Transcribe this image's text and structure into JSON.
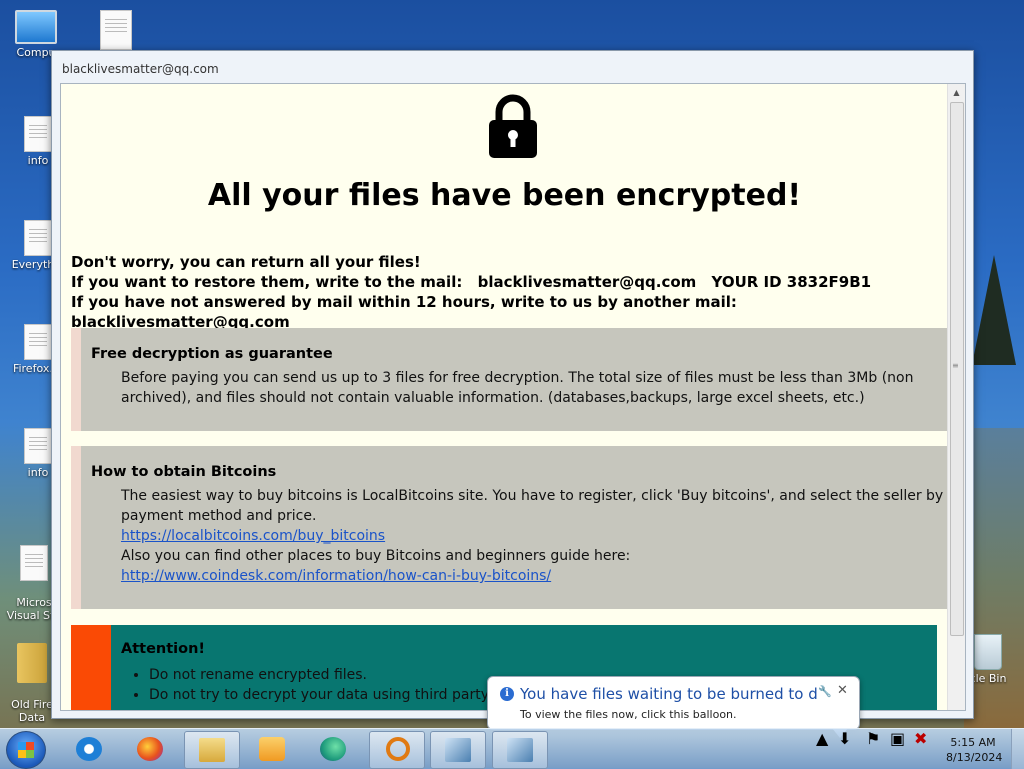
{
  "desktop": {
    "icons": [
      {
        "label": "Compu",
        "icon": "computer-icon"
      },
      {
        "label": "",
        "icon": "document-icon"
      },
      {
        "label": "info",
        "icon": "document-icon"
      },
      {
        "label": "Everythin",
        "icon": "document-icon"
      },
      {
        "label": "Firefox.In",
        "icon": "document-icon"
      },
      {
        "label": "info",
        "icon": "document-icon"
      },
      {
        "label": "Micros\nVisual Stu",
        "icon": "document-icon"
      },
      {
        "label": "Old Fire\nData",
        "icon": "folder-icon"
      },
      {
        "label": "cle Bin",
        "icon": "recycle-bin-icon"
      }
    ]
  },
  "window": {
    "title": "blacklivesmatter@qq.com",
    "headline": "All your files have been encrypted!",
    "intro": {
      "line1": "Don't worry, you can return all your files!",
      "line2_prefix": "If you want to restore them, write to the mail:",
      "line2_email": "blacklivesmatter@qq.com",
      "line2_id": "YOUR ID 3832F9B1",
      "line3_prefix": "If you have not answered by mail within 12 hours, write to us by another mail:",
      "line3_email": "blacklivesmatter@qq.com"
    },
    "free_decryption": {
      "title": "Free decryption as guarantee",
      "body": "Before paying you can send us up to 3 files for free decryption. The total size of files must be less than 3Mb (non archived), and files should not contain valuable information. (databases,backups, large excel sheets, etc.)"
    },
    "bitcoins": {
      "title": "How to obtain Bitcoins",
      "body1": "The easiest way to buy bitcoins is LocalBitcoins site. You have to register, click 'Buy bitcoins', and select the seller by payment method and price.",
      "link1": "https://localbitcoins.com/buy_bitcoins",
      "body2": "Also you can find other places to buy Bitcoins and beginners guide here:",
      "link2": "http://www.coindesk.com/information/how-can-i-buy-bitcoins/"
    },
    "attention": {
      "title": "Attention!",
      "items": [
        "Do not rename encrypted files.",
        "Do not try to decrypt your data using third party so"
      ]
    }
  },
  "balloon": {
    "title": "You have files waiting to be burned to disc",
    "text": "To view the files now, click this balloon."
  },
  "taskbar": {
    "apps": [
      {
        "name": "internet-explorer-icon",
        "color": "#1e7fd6"
      },
      {
        "name": "firefox-icon",
        "color": "#e8521d"
      },
      {
        "name": "file-explorer-icon",
        "color": "#e7c465"
      },
      {
        "name": "media-player-icon",
        "color": "#f09a22"
      },
      {
        "name": "edge-icon",
        "color": "#1f9c7c"
      },
      {
        "name": "search-app-icon",
        "color": "#e07a12"
      },
      {
        "name": "installer-icon",
        "color": "#4a7fb0"
      },
      {
        "name": "installer-icon-2",
        "color": "#4a7fb0"
      }
    ],
    "time": "5:15 AM",
    "date": "8/13/2024"
  },
  "colors": {
    "page_bg": "#ffffee",
    "panel_bg": "#c6c6bd",
    "attention_bg": "#087670",
    "attention_bar": "#fa4a05",
    "link": "#1a53c9"
  }
}
